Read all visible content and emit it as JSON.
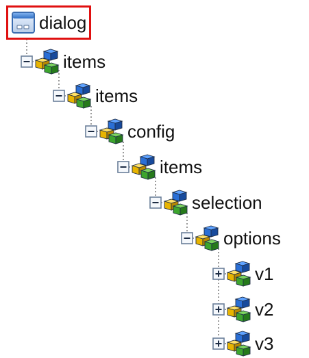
{
  "tree": {
    "root": {
      "label": "dialog",
      "icon": "dialog-window-icon",
      "selected": true,
      "highlight_color": "#e01010"
    },
    "nodes": [
      {
        "label": "items",
        "depth": 1,
        "expanded": true,
        "icon": "component-node-icon"
      },
      {
        "label": "items",
        "depth": 2,
        "expanded": true,
        "icon": "component-node-icon"
      },
      {
        "label": "config",
        "depth": 3,
        "expanded": true,
        "icon": "component-node-icon"
      },
      {
        "label": "items",
        "depth": 4,
        "expanded": true,
        "icon": "component-node-icon"
      },
      {
        "label": "selection",
        "depth": 5,
        "expanded": true,
        "icon": "component-node-icon"
      },
      {
        "label": "options",
        "depth": 6,
        "expanded": true,
        "icon": "component-node-icon"
      },
      {
        "label": "v1",
        "depth": 7,
        "expanded": false,
        "icon": "component-node-icon"
      },
      {
        "label": "v2",
        "depth": 7,
        "expanded": false,
        "icon": "component-node-icon"
      },
      {
        "label": "v3",
        "depth": 7,
        "expanded": false,
        "icon": "component-node-icon"
      }
    ],
    "colors": {
      "connector": "#999999",
      "toggle_border": "#6b7f99",
      "cube_blue": "#2a6fd6",
      "cube_yellow": "#e8b400",
      "cube_green": "#3da52d"
    }
  }
}
